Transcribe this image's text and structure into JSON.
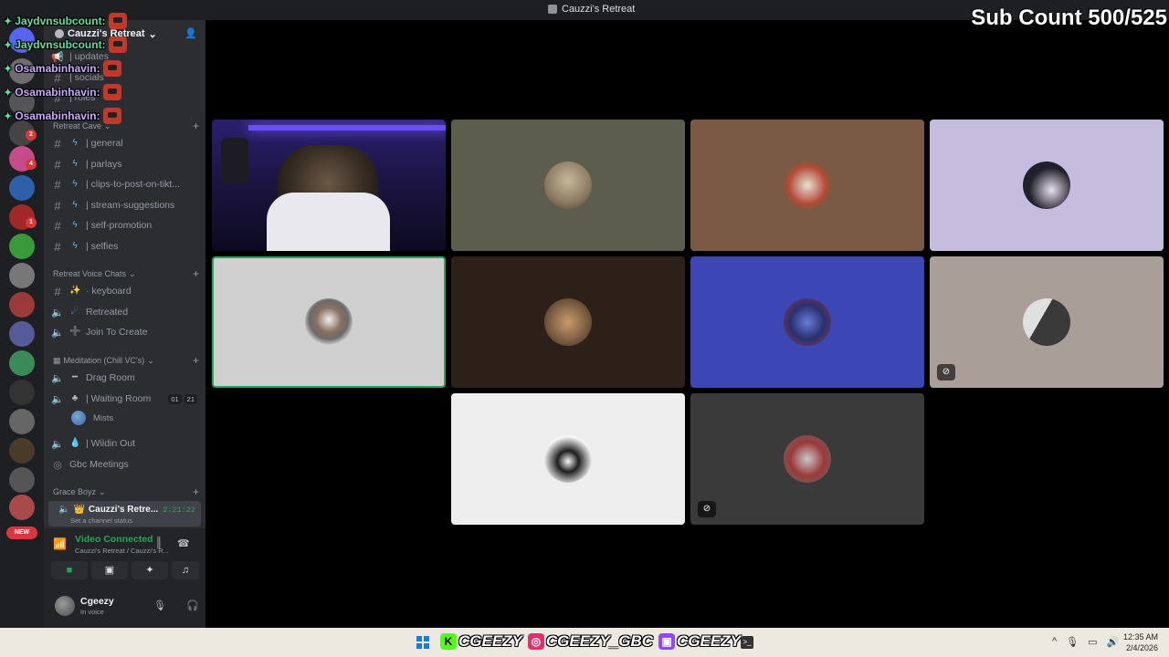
{
  "window": {
    "title": "Cauzzi's Retreat"
  },
  "overlay": {
    "sub_count": "Sub Count 500/525",
    "chat": [
      {
        "name": "Jaydvnsubcount:",
        "color": "#5be0a5"
      },
      {
        "name": "Jaydvnsubcount:",
        "color": "#5be0a5"
      },
      {
        "name": "Osamabinhavin:",
        "color": "#c9a7ff"
      },
      {
        "name": "Osamabinhavin:",
        "color": "#c9a7ff"
      },
      {
        "name": "Osamabinhavin:",
        "color": "#c9a7ff"
      }
    ]
  },
  "server_list": {
    "badges": [
      "2",
      "4",
      "1"
    ],
    "new_badge": "NEW"
  },
  "sidebar": {
    "server_name": "Cauzzi's Retreat",
    "top_channels": [
      {
        "label": "| updates"
      },
      {
        "label": "| socials"
      },
      {
        "label": "| roles"
      }
    ],
    "category_retreat_cave": "Retreat Cave",
    "text_channels": [
      {
        "label": "| general"
      },
      {
        "label": "| parlays"
      },
      {
        "label": "| clips-to-post-on-tikt..."
      },
      {
        "label": "| stream-suggestions"
      },
      {
        "label": "| self-promotion"
      },
      {
        "label": "| selfies"
      }
    ],
    "category_voice": "Retreat Voice Chats",
    "voice_channels": [
      {
        "label": "· keyboard",
        "type": "text",
        "emoji": "✨"
      },
      {
        "label": "Retreated",
        "type": "voice",
        "emoji": "☄"
      },
      {
        "label": "Join To Create",
        "type": "voice",
        "emoji": "➕"
      }
    ],
    "category_meditation": "Meditation (Chill VC's)",
    "meditation_channels": [
      {
        "label": "Drag Room",
        "emoji": "━"
      },
      {
        "label": "| Waiting Room",
        "emoji": "♣"
      },
      {
        "label": "| Wildin Out",
        "emoji": "💧"
      },
      {
        "label": "Gbc Meetings",
        "emoji": ""
      }
    ],
    "waiting_room_counts": [
      "01",
      "21"
    ],
    "waiting_room_user": "Mists",
    "category_grace": "Grace Boyz",
    "current_channel": {
      "name": "Cauzzi's Retre...",
      "timer": "2:21:22",
      "status": "Set a channel status"
    }
  },
  "voice_panel": {
    "status": "Video Connected",
    "location": "Cauzzi's Retreat / Cauzzi's R..."
  },
  "user": {
    "name": "Cgeezy",
    "status": "In voice"
  },
  "video_tiles": [
    {
      "kind": "live",
      "bg": "#1b1440"
    },
    {
      "kind": "avatar",
      "bg": "#5c5d4c",
      "avatar_color": "#8a7a62"
    },
    {
      "kind": "avatar",
      "bg": "#7a5a44",
      "avatar_color": "#b44a3a"
    },
    {
      "kind": "avatar",
      "bg": "#c6bcde",
      "avatar_color": "#20212a"
    },
    {
      "kind": "avatar",
      "bg": "#d0d0d0",
      "avatar_color": "#6b6b6b",
      "speaking": true
    },
    {
      "kind": "avatar",
      "bg": "#2c2018",
      "avatar_color": "#8b6a4a"
    },
    {
      "kind": "avatar",
      "bg": "#3c46b4",
      "avatar_color": "#2a3070"
    },
    {
      "kind": "avatar",
      "bg": "#a99f98",
      "avatar_color": "#3a3a3a",
      "cam_off": true
    },
    {
      "kind": "avatar",
      "bg": "#eeeeee",
      "avatar_color": "#1e1e1e"
    },
    {
      "kind": "avatar",
      "bg": "#3a3a3a",
      "avatar_color": "#9a3a3a",
      "cam_off": true
    }
  ],
  "taskbar": {
    "socials": [
      {
        "icon": "kick-icon",
        "text": "CGEEZY",
        "color": "#53fc18"
      },
      {
        "icon": "instagram-icon",
        "text": "CGEEZY_GBC",
        "color": "#e1306c"
      },
      {
        "icon": "twitch-icon",
        "text": "CGEEZY",
        "color": "#9146ff"
      }
    ],
    "time": "12:35 AM",
    "date": "2/4/2026"
  }
}
